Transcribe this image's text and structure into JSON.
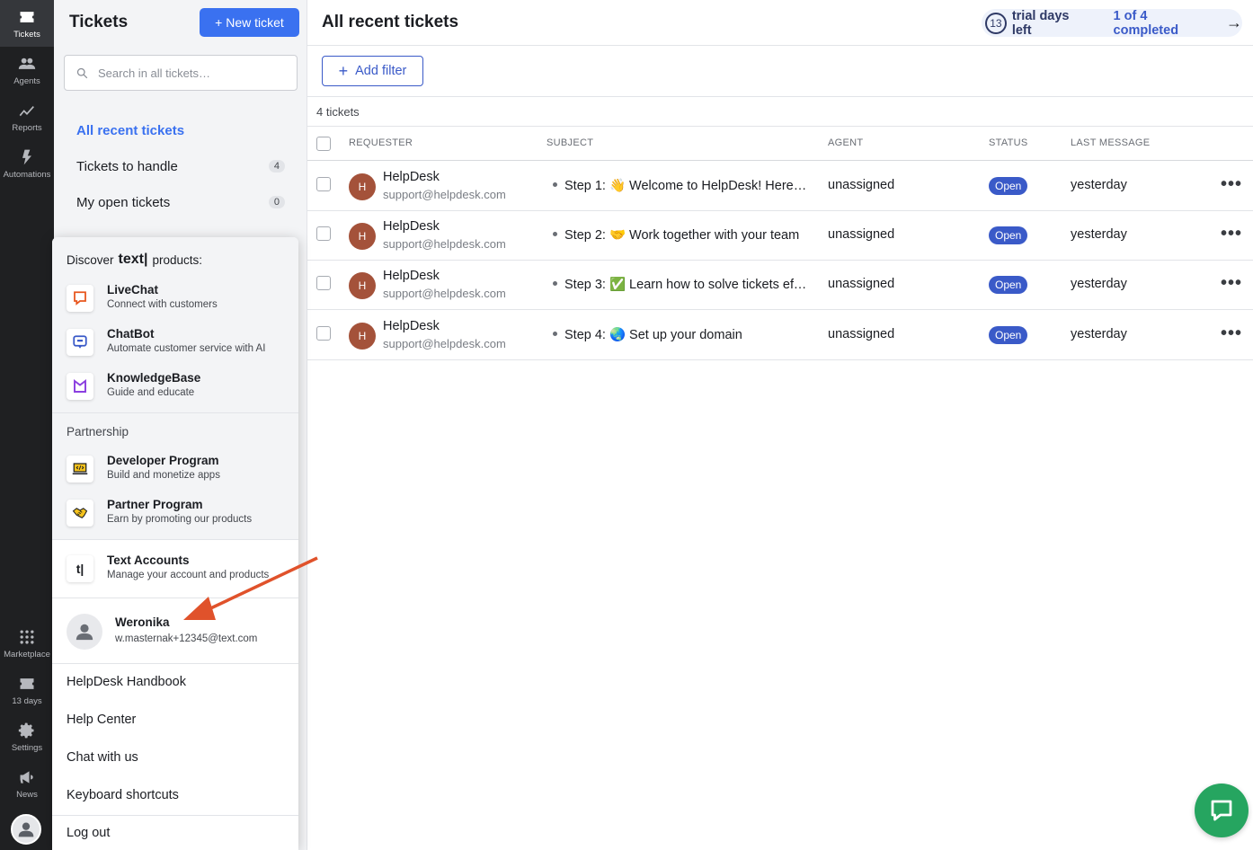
{
  "rail": {
    "items": [
      {
        "label": "Tickets",
        "icon": "ticket-icon"
      },
      {
        "label": "Agents",
        "icon": "agents-icon"
      },
      {
        "label": "Reports",
        "icon": "reports-icon"
      },
      {
        "label": "Automations",
        "icon": "bolt-icon"
      },
      {
        "label": "Marketplace",
        "icon": "grid-icon"
      },
      {
        "label": "13 days",
        "icon": "ticket-icon"
      },
      {
        "label": "Settings",
        "icon": "gear-icon"
      },
      {
        "label": "News",
        "icon": "megaphone-icon"
      }
    ]
  },
  "sidebar": {
    "title": "Tickets",
    "new_ticket": "+ New ticket",
    "search_placeholder": "Search in all tickets…",
    "nav": [
      {
        "label": "All recent tickets",
        "count": ""
      },
      {
        "label": "Tickets to handle",
        "count": "4"
      },
      {
        "label": "My open tickets",
        "count": "0"
      }
    ]
  },
  "header": {
    "title": "All recent tickets",
    "trial_days": "13",
    "trial_text": "trial days left",
    "completed": "1 of 4 completed",
    "arrow": "→"
  },
  "filters": {
    "add_filter": "Add filter",
    "ticket_count": "4 tickets"
  },
  "table": {
    "columns": [
      "REQUESTER",
      "SUBJECT",
      "AGENT",
      "STATUS",
      "LAST MESSAGE"
    ],
    "rows": [
      {
        "initial": "H",
        "name": "HelpDesk",
        "email": "support@helpdesk.com",
        "subject": "Step 1: 👋 Welcome to HelpDesk! Here’s …",
        "agent": "unassigned",
        "status": "Open",
        "last": "yesterday"
      },
      {
        "initial": "H",
        "name": "HelpDesk",
        "email": "support@helpdesk.com",
        "subject": "Step 2: 🤝 Work together with your team",
        "agent": "unassigned",
        "status": "Open",
        "last": "yesterday"
      },
      {
        "initial": "H",
        "name": "HelpDesk",
        "email": "support@helpdesk.com",
        "subject": "Step 3: ✅ Learn how to solve tickets effe…",
        "agent": "unassigned",
        "status": "Open",
        "last": "yesterday"
      },
      {
        "initial": "H",
        "name": "HelpDesk",
        "email": "support@helpdesk.com",
        "subject": "Step 4: 🌏 Set up your domain",
        "agent": "unassigned",
        "status": "Open",
        "last": "yesterday"
      }
    ]
  },
  "popup": {
    "discover_prefix": "Discover",
    "discover_brand": "text|",
    "discover_suffix": "products:",
    "products": [
      {
        "name": "LiveChat",
        "desc": "Connect with customers",
        "icon": "livechat-icon"
      },
      {
        "name": "ChatBot",
        "desc": "Automate customer service with AI",
        "icon": "chatbot-icon"
      },
      {
        "name": "KnowledgeBase",
        "desc": "Guide and educate",
        "icon": "knowledgebase-icon"
      }
    ],
    "partnership_label": "Partnership",
    "partners": [
      {
        "name": "Developer Program",
        "desc": "Build and monetize apps",
        "icon": "developer-icon"
      },
      {
        "name": "Partner Program",
        "desc": "Earn by promoting our products",
        "icon": "handshake-icon"
      }
    ],
    "accounts": {
      "name": "Text Accounts",
      "desc": "Manage your account and products",
      "glyph": "t|"
    },
    "user": {
      "name": "Weronika",
      "email": "w.masternak+12345@text.com"
    },
    "links": [
      "HelpDesk Handbook",
      "Help Center",
      "Chat with us",
      "Keyboard shortcuts",
      "Log out"
    ]
  },
  "colors": {
    "accent": "#3a71f0",
    "status_open": "#3a5ac8",
    "annotation_arrow": "#e0522b",
    "chat_button": "#26a560",
    "avatar": "#a4523a"
  }
}
